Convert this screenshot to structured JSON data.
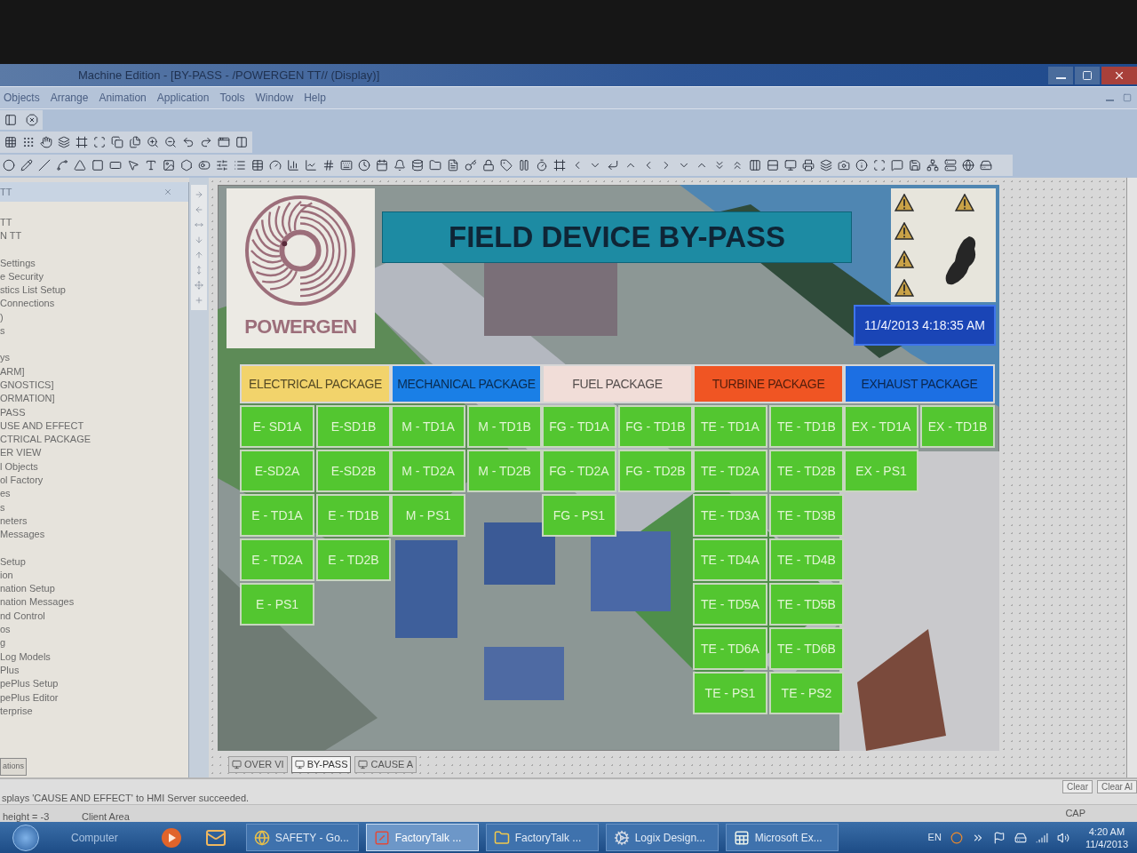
{
  "window": {
    "title": "Machine Edition - [BY-PASS - /POWERGEN TT// (Display)]"
  },
  "menu": [
    "Objects",
    "Arrange",
    "Animation",
    "Application",
    "Tools",
    "Window",
    "Help"
  ],
  "explorer": {
    "title": "TT",
    "groups": [
      [
        "TT",
        "N TT"
      ],
      [
        "Settings",
        "e Security",
        "stics List Setup",
        "Connections",
        ")",
        "s"
      ],
      [
        "ys",
        "ARM]",
        "GNOSTICS]",
        "ORMATION]",
        "PASS",
        "USE AND EFFECT",
        "CTRICAL PACKAGE",
        "ER VIEW",
        "l Objects",
        "ol Factory",
        "es",
        "s",
        "neters",
        "Messages"
      ],
      [
        "Setup",
        "ion",
        "nation Setup",
        "nation Messages",
        "nd Control",
        "os",
        "g",
        "Log Models",
        "Plus",
        "pePlus Setup",
        "pePlus Editor",
        "terprise"
      ]
    ],
    "tab": "ations"
  },
  "display": {
    "logo_text": "POWERGEN",
    "title": "FIELD DEVICE BY-PASS",
    "datetime": "11/4/2013 4:18:35 AM",
    "packages": [
      {
        "title": "ELECTRICAL PACKAGE",
        "color": "#f2d36b",
        "devices": [
          [
            "E- SD1A",
            "E-SD1B"
          ],
          [
            "E-SD2A",
            "E-SD2B"
          ],
          [
            "E - TD1A",
            "E - TD1B"
          ],
          [
            "E - TD2A",
            "E - TD2B"
          ],
          [
            "E - PS1"
          ]
        ]
      },
      {
        "title": "MECHANICAL PACKAGE",
        "color": "#1a7fe6",
        "devices": [
          [
            "M - TD1A",
            "M - TD1B"
          ],
          [
            "M - TD2A",
            "M - TD2B"
          ],
          [
            "M - PS1"
          ]
        ]
      },
      {
        "title": "FUEL PACKAGE",
        "color": "#f1ddd8",
        "devices": [
          [
            "FG - TD1A",
            "FG - TD1B"
          ],
          [
            "FG - TD2A",
            "FG - TD2B"
          ],
          [
            "FG - PS1"
          ]
        ]
      },
      {
        "title": "TURBINE PACKAGE",
        "color": "#f05523",
        "devices": [
          [
            "TE - TD1A",
            "TE - TD1B"
          ],
          [
            "TE - TD2A",
            "TE - TD2B"
          ],
          [
            "TE - TD3A",
            "TE - TD3B"
          ],
          [
            "TE - TD4A",
            "TE - TD4B"
          ],
          [
            "TE - TD5A",
            "TE - TD5B"
          ],
          [
            "TE - TD6A",
            "TE - TD6B"
          ],
          [
            "TE - PS1",
            "TE - PS2"
          ]
        ]
      },
      {
        "title": "EXHAUST PACKAGE",
        "color": "#1c6fe3",
        "devices": [
          [
            "EX - TD1A",
            "EX - TD1B"
          ],
          [
            "EX - PS1"
          ]
        ]
      }
    ]
  },
  "display_tabs": [
    {
      "label": "OVER VI",
      "selected": false
    },
    {
      "label": "BY-PASS",
      "selected": true
    },
    {
      "label": "CAUSE A",
      "selected": false
    }
  ],
  "output": {
    "message": "splays 'CAUSE AND EFFECT' to HMI Server succeeded.",
    "buttons": [
      "Clear",
      "Clear Al"
    ]
  },
  "status_bar": {
    "left": [
      "height = -3",
      "Client Area"
    ],
    "right": "CAP"
  },
  "taskbar": {
    "start_label": "Computer",
    "windows": [
      {
        "label": "SAFETY - Go...",
        "selected": false
      },
      {
        "label": "FactoryTalk ...",
        "selected": true
      },
      {
        "label": "FactoryTalk ...",
        "selected": false
      },
      {
        "label": "Logix Design...",
        "selected": false
      },
      {
        "label": "Microsoft Ex...",
        "selected": false
      }
    ],
    "language": "EN",
    "time": "4:20 AM",
    "date": "11/4/2013"
  }
}
